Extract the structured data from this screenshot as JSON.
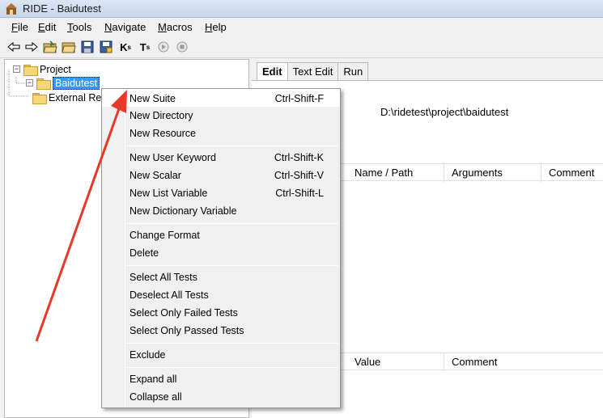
{
  "window": {
    "title": "RIDE - Baidutest"
  },
  "menubar": [
    "File",
    "Edit",
    "Tools",
    "Navigate",
    "Macros",
    "Help"
  ],
  "toolbar": [
    "back-arrow",
    "forward-arrow",
    "open-suite",
    "open-directory",
    "save",
    "save-all",
    "search-keywords",
    "search-tests",
    "run-forward",
    "stop"
  ],
  "tree": {
    "root": "Project",
    "child": "Baidutest",
    "external": "External Resources"
  },
  "tabs": [
    "Edit",
    "Text Edit",
    "Run"
  ],
  "editor": {
    "path": "D:\\ridetest\\project\\baidutest",
    "table1": [
      "Name / Path",
      "Arguments",
      "Comment"
    ],
    "table2": [
      "Value",
      "Comment"
    ]
  },
  "context_menu": {
    "groups": [
      [
        {
          "label": "New Suite",
          "shortcut": "Ctrl-Shift-F"
        },
        {
          "label": "New Directory",
          "shortcut": ""
        },
        {
          "label": "New Resource",
          "shortcut": ""
        }
      ],
      [
        {
          "label": "New User Keyword",
          "shortcut": "Ctrl-Shift-K"
        },
        {
          "label": "New Scalar",
          "shortcut": "Ctrl-Shift-V"
        },
        {
          "label": "New List Variable",
          "shortcut": "Ctrl-Shift-L"
        },
        {
          "label": "New Dictionary Variable",
          "shortcut": ""
        }
      ],
      [
        {
          "label": "Change Format",
          "shortcut": ""
        },
        {
          "label": "Delete",
          "shortcut": ""
        }
      ],
      [
        {
          "label": "Select All Tests",
          "shortcut": ""
        },
        {
          "label": "Deselect All Tests",
          "shortcut": ""
        },
        {
          "label": "Select Only Failed Tests",
          "shortcut": ""
        },
        {
          "label": "Select Only Passed Tests",
          "shortcut": ""
        }
      ],
      [
        {
          "label": "Exclude",
          "shortcut": ""
        }
      ],
      [
        {
          "label": "Expand all",
          "shortcut": ""
        },
        {
          "label": "Collapse all",
          "shortcut": ""
        }
      ]
    ]
  },
  "colors": {
    "annotation_arrow": "#e8382a",
    "selection": "#3399ff"
  }
}
